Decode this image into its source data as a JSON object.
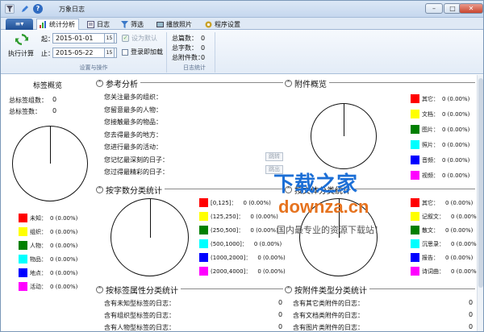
{
  "window": {
    "title": "万象日志",
    "minimize": "–",
    "maximize": "□",
    "close": "✕"
  },
  "quick_access": [
    {
      "name": "filter-icon"
    },
    {
      "name": "edit-icon"
    },
    {
      "name": "help-icon"
    }
  ],
  "ribbon_tabs": [
    {
      "label": "统计分析",
      "icon": "chart-icon",
      "active": true
    },
    {
      "label": "日志",
      "icon": "log-icon"
    },
    {
      "label": "筛选",
      "icon": "filter-icon"
    },
    {
      "label": "播放照片",
      "icon": "slideshow-icon"
    },
    {
      "label": "程序设置",
      "icon": "settings-icon"
    }
  ],
  "app_menu": {
    "label": "≡▾"
  },
  "ribbon": {
    "exec_label": "执行计算",
    "start_label": "起：",
    "start_date": "2015-01-01",
    "end_label": "止：",
    "end_date": "2015-05-22",
    "set_default": "设为默认",
    "login_load": "登录即加载",
    "group1_label": "设置与操作",
    "stats": [
      {
        "label": "总篇数：",
        "value": "0"
      },
      {
        "label": "总字数：",
        "value": "0"
      },
      {
        "label": "总附件数：",
        "value": "0"
      }
    ],
    "group2_label": "日志统计"
  },
  "tag_overview": {
    "title": "标签概览",
    "total_groups_label": "总标签组数：",
    "total_groups": "0",
    "total_tags_label": "总标签数：",
    "total_tags": "0",
    "legend": [
      {
        "label": "未知：",
        "value": "0 (0.00%)",
        "color": "#ff0000"
      },
      {
        "label": "组织：",
        "value": "0 (0.00%)",
        "color": "#ffff00"
      },
      {
        "label": "人物：",
        "value": "0 (0.00%)",
        "color": "#008000"
      },
      {
        "label": "物品：",
        "value": "0 (0.00%)",
        "color": "#00ffff"
      },
      {
        "label": "地点：",
        "value": "0 (0.00%)",
        "color": "#0000ff"
      },
      {
        "label": "活动：",
        "value": "0 (0.00%)",
        "color": "#ff00ff"
      }
    ]
  },
  "reference": {
    "title": "参考分析",
    "collapse": "⌃",
    "rows": [
      "您关注最多的组织：",
      "您留意最多的人物：",
      "您接触最多的物品：",
      "您去得最多的地方：",
      "您进行最多的活动：",
      "您记忆最深刻的日子：",
      "您过得最精彩的日子："
    ],
    "btn1": "跳转",
    "btn2": "跳出"
  },
  "attachment_overview": {
    "title": "附件概览",
    "legend": [
      {
        "label": "其它：",
        "value": "0 (0.00%)",
        "color": "#ff0000"
      },
      {
        "label": "文档：",
        "value": "0 (0.00%)",
        "color": "#ffff00"
      },
      {
        "label": "图片：",
        "value": "0 (0.00%)",
        "color": "#008000"
      },
      {
        "label": "照片：",
        "value": "0 (0.00%)",
        "color": "#00ffff"
      },
      {
        "label": "音频：",
        "value": "0 (0.00%)",
        "color": "#0000ff"
      },
      {
        "label": "视频：",
        "value": "0 (0.00%)",
        "color": "#ff00ff"
      }
    ]
  },
  "wordcount_stats": {
    "title": "按字数分类统计",
    "legend": [
      {
        "label": "[0,125]：",
        "value": "0 (0.00%)",
        "color": "#ff0000"
      },
      {
        "label": "(125,250]：",
        "value": "0 (0.00%)",
        "color": "#ffff00"
      },
      {
        "label": "(250,500]：",
        "value": "0 (0.00%)",
        "color": "#008000"
      },
      {
        "label": "(500,1000]：",
        "value": "0 (0.00%)",
        "color": "#00ffff"
      },
      {
        "label": "(1000,2000]：",
        "value": "0 (0.00%)",
        "color": "#0000ff"
      },
      {
        "label": "(2000,4000]：",
        "value": "0 (0.00%)",
        "color": "#ff00ff"
      }
    ]
  },
  "genre_stats": {
    "title": "按文体分类统计",
    "legend": [
      {
        "label": "其它：",
        "value": "0 (0.00%)",
        "color": "#ff0000"
      },
      {
        "label": "记叙文：",
        "value": "0 (0.00%)",
        "color": "#ffff00"
      },
      {
        "label": "散文：",
        "value": "0 (0.00%)",
        "color": "#008000"
      },
      {
        "label": "沉思录：",
        "value": "0 (0.00%)",
        "color": "#00ffff"
      },
      {
        "label": "报告：",
        "value": "0 (0.00%)",
        "color": "#0000ff"
      },
      {
        "label": "诗词曲：",
        "value": "0 (0.00%)",
        "color": "#ff00ff"
      }
    ]
  },
  "tag_attr_stats": {
    "title": "按标签属性分类统计",
    "rows": [
      {
        "label": "含有未知型标签的日志：",
        "value": "0"
      },
      {
        "label": "含有组织型标签的日志：",
        "value": "0"
      },
      {
        "label": "含有人物型标签的日志：",
        "value": "0"
      }
    ]
  },
  "attach_type_stats": {
    "title": "按附件类型分类统计",
    "rows": [
      {
        "label": "含有其它类附件的日志：",
        "value": "0"
      },
      {
        "label": "含有文档类附件的日志：",
        "value": "0"
      },
      {
        "label": "含有图片类附件的日志：",
        "value": "0"
      }
    ]
  },
  "watermark": {
    "line1": "下载之家",
    "line2": "downza.cn",
    "line3": "国内最专业的资源下载站！"
  }
}
